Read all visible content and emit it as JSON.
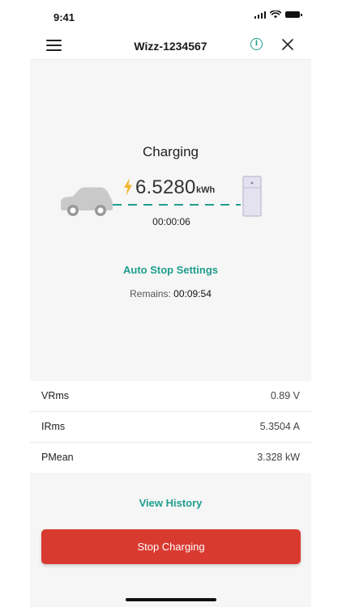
{
  "status_bar": {
    "time": "9:41"
  },
  "header": {
    "title": "Wizz-1234567",
    "icons": [
      "menu-icon",
      "info-icon",
      "close-icon"
    ]
  },
  "charging": {
    "status": "Charging",
    "energy_value": "6.5280",
    "energy_unit": "kWh",
    "elapsed": "00:00:06",
    "auto_stop_label": "Auto Stop Settings",
    "remains_label": "Remains:",
    "remains_value": "00:09:54"
  },
  "metrics": [
    {
      "label": "VRms",
      "value": "0.89 V"
    },
    {
      "label": "IRms",
      "value": "5.3504 A"
    },
    {
      "label": "PMean",
      "value": "3.328 kW"
    }
  ],
  "actions": {
    "view_history_label": "View History",
    "stop_label": "Stop Charging"
  },
  "colors": {
    "accent": "#1f9e8e",
    "stop_button": "#d93a30",
    "bolt": "#f2b630",
    "panel_bg": "#f6f6f6"
  }
}
